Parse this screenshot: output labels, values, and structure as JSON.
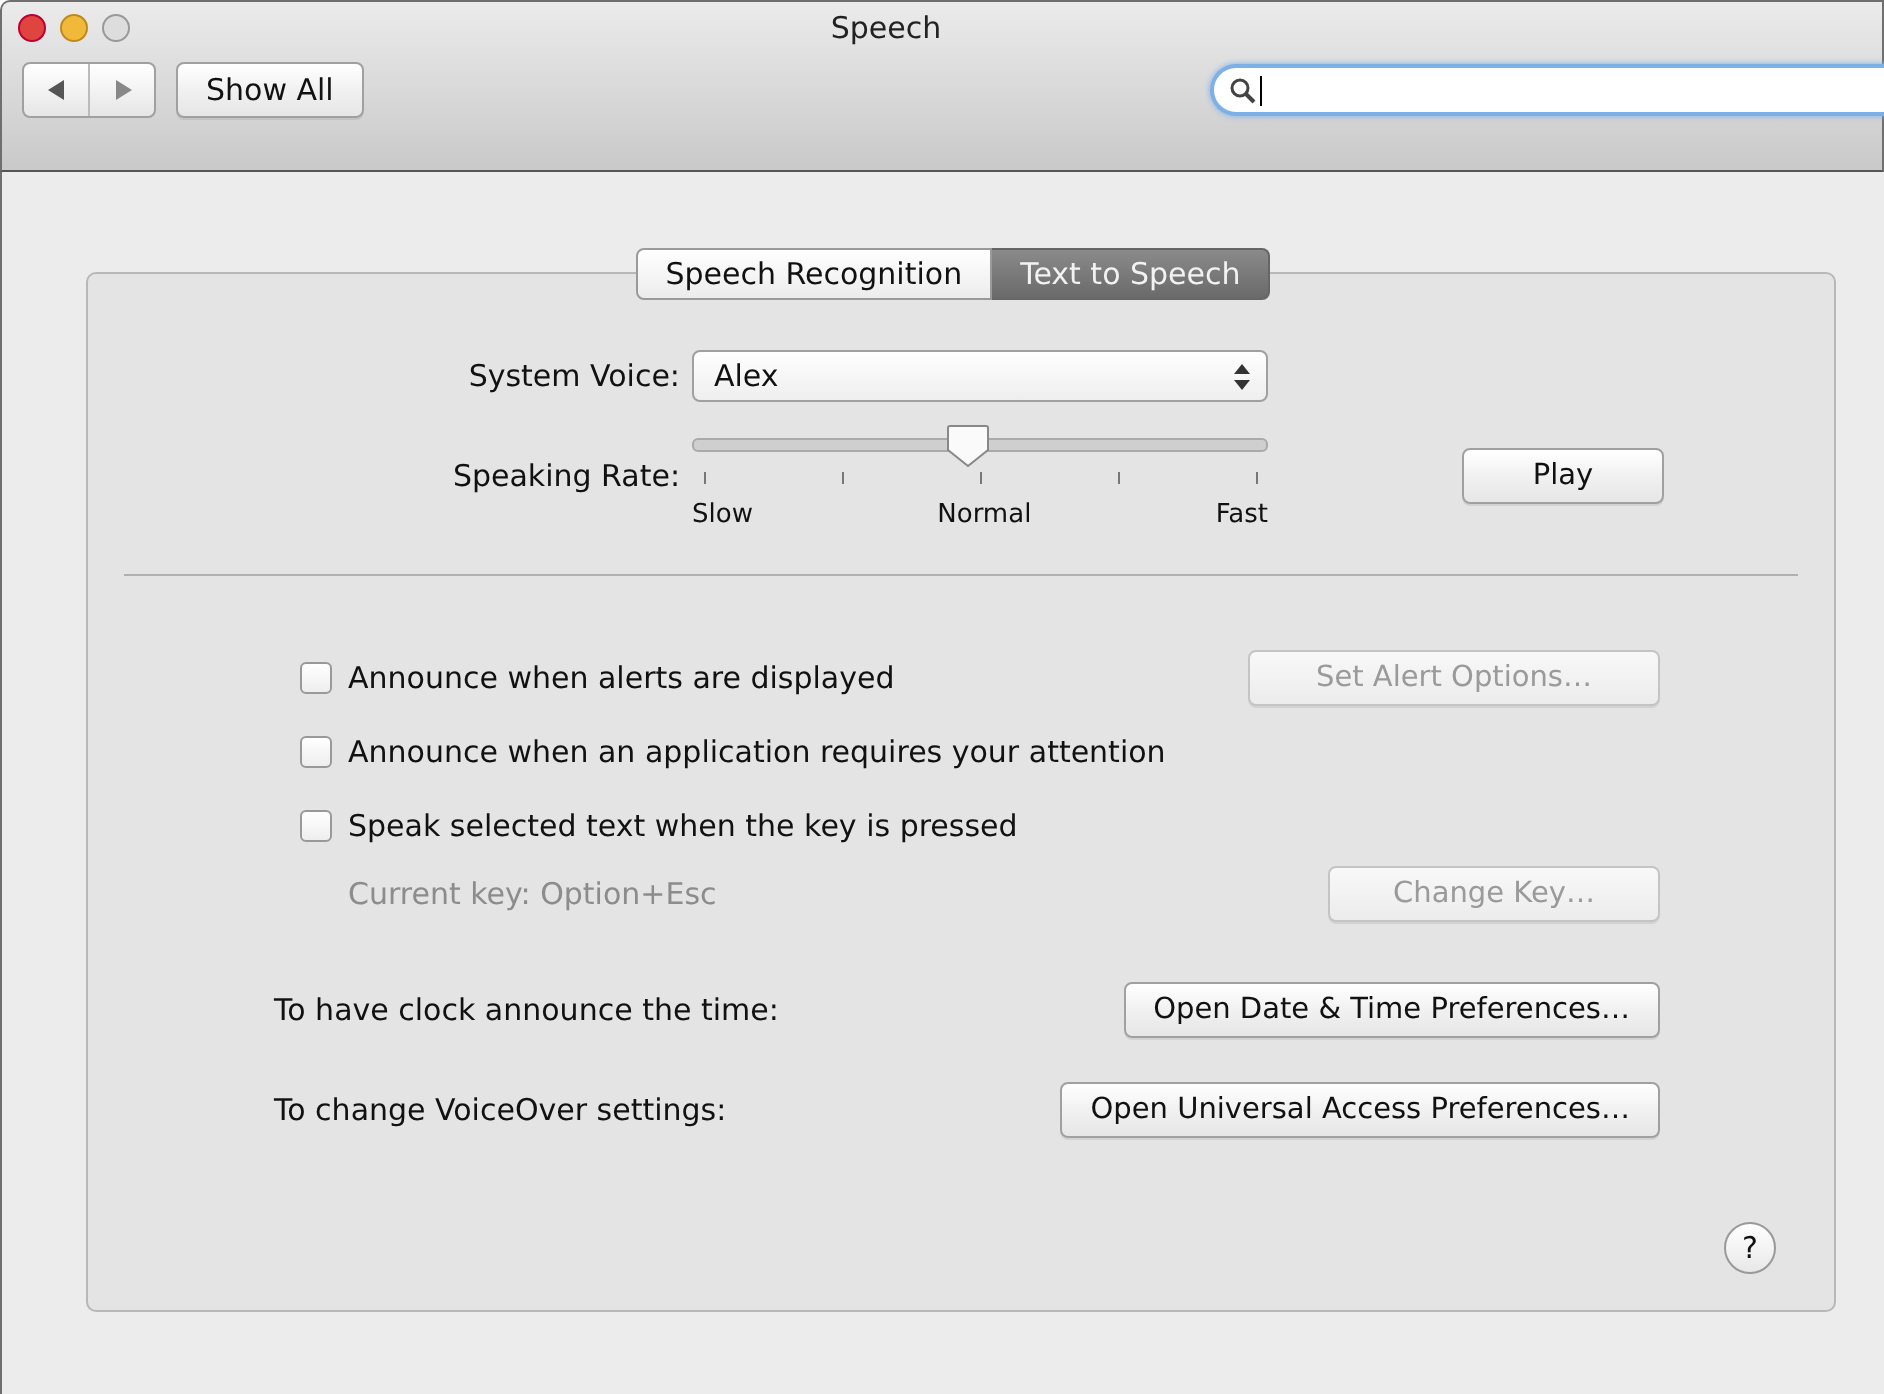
{
  "window": {
    "title": "Speech"
  },
  "toolbar": {
    "show_all": "Show All"
  },
  "tabs": [
    {
      "label": "Speech Recognition",
      "selected": false
    },
    {
      "label": "Text to Speech",
      "selected": true
    }
  ],
  "system_voice": {
    "label": "System Voice:",
    "value": "Alex"
  },
  "speaking_rate": {
    "label": "Speaking Rate:",
    "level": 0.48,
    "tick_labels": [
      "Slow",
      "Normal",
      "Fast"
    ]
  },
  "play_button": "Play",
  "options": [
    {
      "label": "Announce when alerts are displayed",
      "checked": false,
      "button": {
        "label": "Set Alert Options…",
        "disabled": true
      }
    },
    {
      "label": "Announce when an application requires your attention",
      "checked": false
    },
    {
      "label": "Speak selected text when the key is pressed",
      "checked": false,
      "note": {
        "text": "Current key: Option+Esc",
        "disabled": true
      },
      "button": {
        "label": "Change Key…",
        "disabled": true
      }
    }
  ],
  "shortcuts": [
    {
      "label": "To have clock announce the time:",
      "button": "Open Date & Time Preferences…"
    },
    {
      "label": "To change VoiceOver settings:",
      "button": "Open Universal Access Preferences…"
    }
  ],
  "help_button": "?"
}
